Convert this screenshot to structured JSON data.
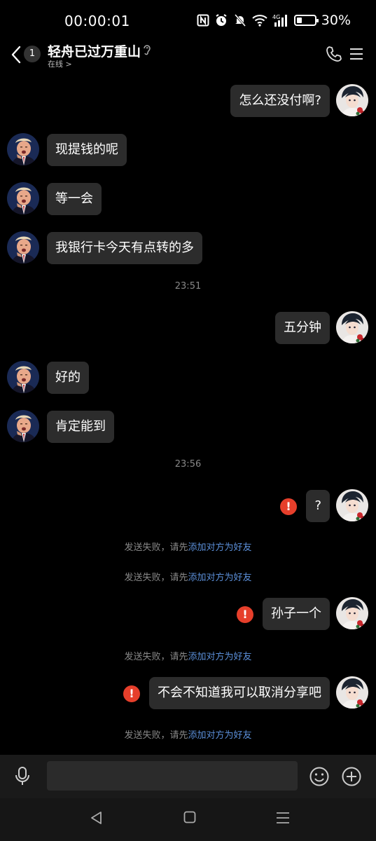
{
  "status_bar": {
    "time": "00:00:01",
    "network_label": "4G",
    "battery_percent": 30,
    "battery_text": "30%",
    "icons": [
      "nfc-icon",
      "alarm-icon",
      "mute-icon",
      "wifi-icon",
      "signal-icon",
      "battery-icon"
    ]
  },
  "header": {
    "unread_count": "1",
    "title": "轻舟已过万重山",
    "status": "在线 >",
    "icons": [
      "back-chevron-icon",
      "ear-icon",
      "phone-icon",
      "menu-icon"
    ]
  },
  "messages": [
    {
      "type": "msg",
      "sender": "self",
      "text": "怎么还没付啊?",
      "error": false
    },
    {
      "type": "msg",
      "sender": "other",
      "text": "现提钱的呢",
      "error": false
    },
    {
      "type": "msg",
      "sender": "other",
      "text": "等一会",
      "error": false
    },
    {
      "type": "msg",
      "sender": "other",
      "text": "我银行卡今天有点转的多",
      "error": false
    },
    {
      "type": "time",
      "text": "23:51"
    },
    {
      "type": "msg",
      "sender": "self",
      "text": "五分钟",
      "error": false
    },
    {
      "type": "msg",
      "sender": "other",
      "text": "好的",
      "error": false
    },
    {
      "type": "msg",
      "sender": "other",
      "text": "肯定能到",
      "error": false
    },
    {
      "type": "time",
      "text": "23:56"
    },
    {
      "type": "msg",
      "sender": "self",
      "text": "?",
      "error": true
    },
    {
      "type": "fail",
      "prefix": "发送失败，请先",
      "link": "添加对方为好友"
    },
    {
      "type": "fail",
      "prefix": "发送失败，请先",
      "link": "添加对方为好友"
    },
    {
      "type": "msg",
      "sender": "self",
      "text": "孙子一个",
      "error": true
    },
    {
      "type": "fail",
      "prefix": "发送失败，请先",
      "link": "添加对方为好友"
    },
    {
      "type": "msg",
      "sender": "self",
      "text": "不会不知道我可以取消分享吧",
      "error": true
    },
    {
      "type": "fail",
      "prefix": "发送失败，请先",
      "link": "添加对方为好友"
    }
  ],
  "error_glyph": "!",
  "input_bar": {
    "placeholder": "",
    "value": "",
    "icons": [
      "mic-icon",
      "emoji-icon",
      "plus-icon"
    ]
  },
  "nav_bar": {
    "icons": [
      "nav-back-icon",
      "nav-home-icon",
      "nav-recent-icon"
    ]
  },
  "colors": {
    "background": "#000000",
    "bubble": "#2c2c2c",
    "error": "#e63f2b",
    "link": "#5b8fd9",
    "muted_text": "#888888"
  }
}
